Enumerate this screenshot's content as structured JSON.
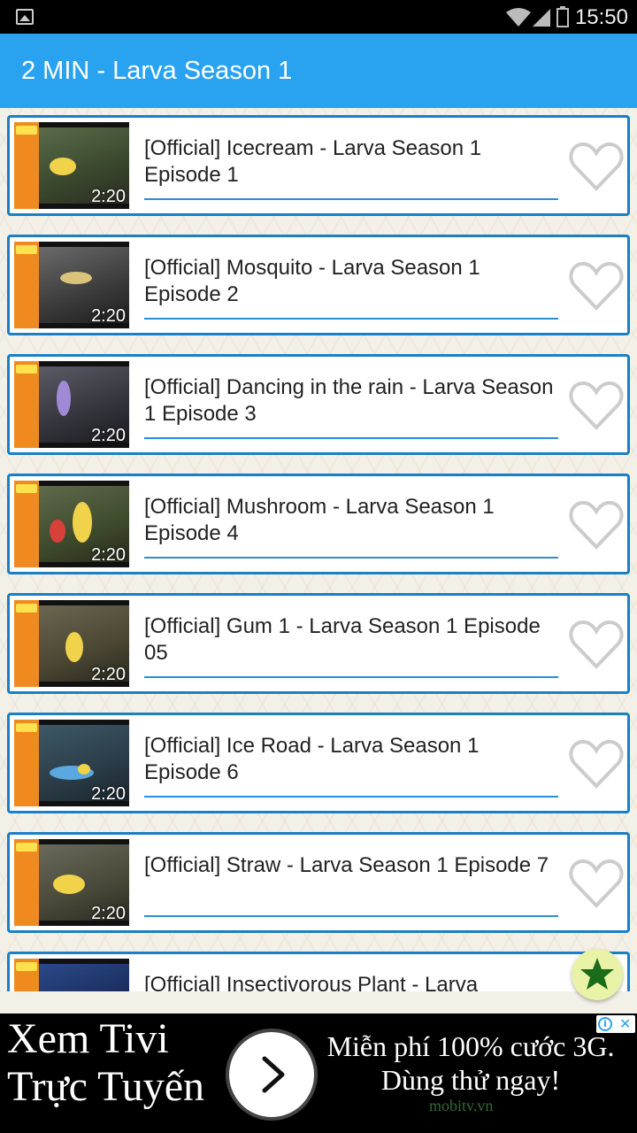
{
  "status_bar": {
    "time": "15:50",
    "icons": [
      "gallery-icon",
      "wifi-icon",
      "signal-icon",
      "battery-icon"
    ]
  },
  "app_bar": {
    "title": "2 MIN - Larva Season 1"
  },
  "videos": [
    {
      "title": "[Official] Icecream - Larva Season 1 Episode 1",
      "duration": "2:20"
    },
    {
      "title": "[Official] Mosquito - Larva Season 1 Episode 2",
      "duration": "2:20"
    },
    {
      "title": "[Official] Dancing in the rain - Larva Season 1 Episode 3",
      "duration": "2:20"
    },
    {
      "title": "[Official] Mushroom - Larva Season 1 Episode 4",
      "duration": "2:20"
    },
    {
      "title": "[Official] Gum 1 - Larva Season 1 Episode 05",
      "duration": "2:20"
    },
    {
      "title": "[Official] Ice Road - Larva Season 1 Episode 6",
      "duration": "2:20"
    },
    {
      "title": "[Official] Straw - Larva Season 1 Episode 7",
      "duration": "2:20"
    },
    {
      "title": "[Official] Insectivorous Plant - Larva",
      "duration": ""
    }
  ],
  "ad": {
    "left_text": "Xem Tivi Trực Tuyến",
    "right_text": "Miễn phí 100% cước 3G. Dùng thử ngay!",
    "brand": "mobitv.vn"
  },
  "colors": {
    "app_bar": "#29a3f0",
    "card_border": "#1a7fc4",
    "fab": "#e9f2a6",
    "star": "#1a6b1a"
  }
}
